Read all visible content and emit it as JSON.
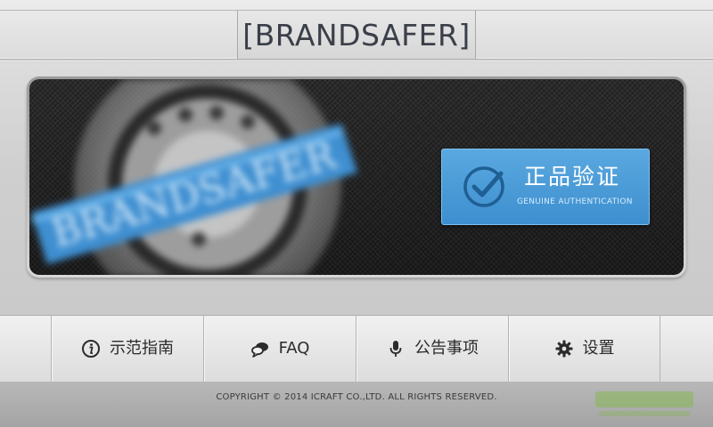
{
  "header": {
    "logo": "[BRANDSAFER]"
  },
  "banner": {
    "seal_text": "BRANDSAFER",
    "verify_button": {
      "title": "正品验证",
      "subtitle": "GENUINE AUTHENTICATION",
      "icon": "checkmark-circle-icon"
    }
  },
  "nav": {
    "items": [
      {
        "label": "示范指南",
        "icon": "info-icon"
      },
      {
        "label": "FAQ",
        "icon": "chat-bubbles-icon"
      },
      {
        "label": "公告事项",
        "icon": "microphone-icon"
      },
      {
        "label": "设置",
        "icon": "gear-icon"
      }
    ]
  },
  "footer": {
    "copyright": "COPYRIGHT © 2014 ICRAFT CO.,LTD. ALL RIGHTS RESERVED."
  },
  "colors": {
    "accent": "#4a9bd8",
    "logo": "#3a3f48",
    "banner_bg": "#222222"
  }
}
